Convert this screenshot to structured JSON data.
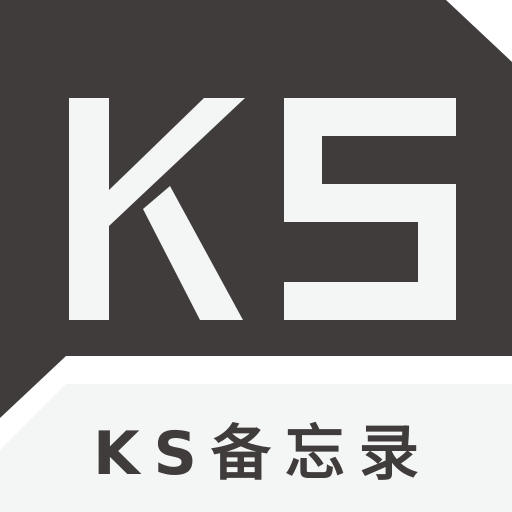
{
  "logo": {
    "monogram": "KS",
    "colors": {
      "dark_panel": "#3f3c3b",
      "light": "#f4f5f5",
      "background": "#ffffff"
    }
  },
  "app_name": "KS备忘录"
}
